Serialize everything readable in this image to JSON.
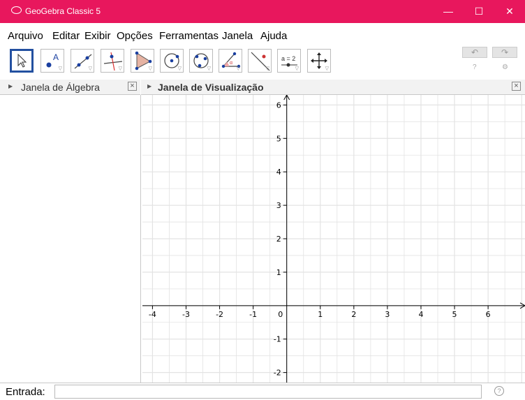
{
  "window": {
    "title": "GeoGebra Classic 5",
    "controls": [
      "—",
      "☐",
      "✕"
    ]
  },
  "menu": [
    "Arquivo",
    "Editar",
    "Exibir",
    "Opções",
    "Ferramentas",
    "Janela",
    "Ajuda"
  ],
  "toolbar": {
    "tools": [
      {
        "name": "move-tool"
      },
      {
        "name": "point-tool"
      },
      {
        "name": "line-tool"
      },
      {
        "name": "perpendicular-line-tool"
      },
      {
        "name": "polygon-tool"
      },
      {
        "name": "circle-center-tool"
      },
      {
        "name": "circle-three-points-tool"
      },
      {
        "name": "angle-tool"
      },
      {
        "name": "reflect-tool"
      },
      {
        "name": "slider-tool"
      },
      {
        "name": "move-graphics-view-tool"
      }
    ],
    "slider_label": "a = 2",
    "undo_glyph": "↶",
    "redo_glyph": "↷",
    "help_glyph": "?",
    "settings_glyph": "⚙"
  },
  "algebra_view": {
    "title": "Janela de Álgebra"
  },
  "graphics_view": {
    "title": "Janela de Visualização",
    "x_ticks": [
      "-4",
      "-3",
      "-2",
      "-1",
      "0",
      "1",
      "2",
      "3",
      "4",
      "5",
      "6"
    ],
    "y_ticks": [
      "6",
      "5",
      "4",
      "3",
      "2",
      "1",
      "-1",
      "-2"
    ],
    "grid": true,
    "x_range": [
      -4.3,
      7.1
    ],
    "y_range": [
      -2.3,
      6.3
    ]
  },
  "input_bar": {
    "label": "Entrada:",
    "value": "",
    "help_glyph": "?"
  },
  "colors": {
    "title_bar": "#e8175d",
    "selected_tool_border": "#2350a0",
    "grid": "#e3e3e3",
    "axes": "#000000"
  }
}
